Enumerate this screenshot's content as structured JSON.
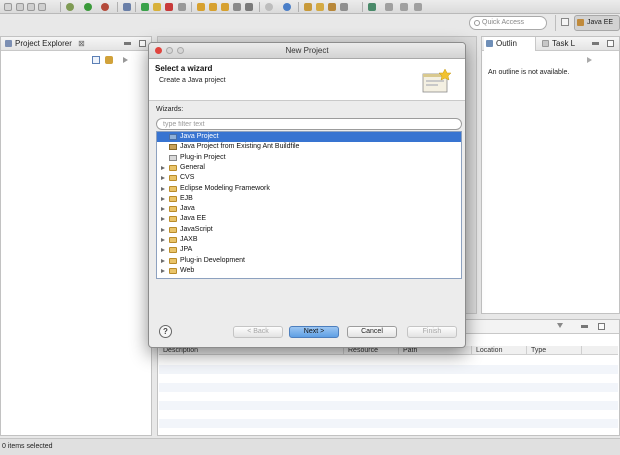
{
  "window": {
    "quick_access_placeholder": "Quick Access",
    "perspective_label": "Java EE"
  },
  "project_explorer": {
    "tab_label": "Project Explorer",
    "tab_close": "⊠"
  },
  "outline": {
    "tab_label": "Outlin",
    "second_tab_label": "Task L",
    "message": "An outline is not available."
  },
  "markers_table": {
    "columns": [
      "Description",
      "Resource",
      "Path",
      "Location",
      "Type"
    ]
  },
  "status_bar": {
    "text": "0 items selected"
  },
  "dialog": {
    "title": "New Project",
    "banner_title": "Select a wizard",
    "banner_description": "Create a Java project",
    "wizards_label": "Wizards:",
    "filter_placeholder": "type filter text",
    "tree": {
      "items": [
        {
          "label": "Java Project",
          "icon": "java-project-icon",
          "selected": true
        },
        {
          "label": "Java Project from Existing Ant Buildfile",
          "icon": "ant-project-icon"
        },
        {
          "label": "Plug-in Project",
          "icon": "plugin-project-icon"
        },
        {
          "label": "General",
          "icon": "folder-icon"
        },
        {
          "label": "CVS",
          "icon": "folder-icon"
        },
        {
          "label": "Eclipse Modeling Framework",
          "icon": "folder-icon"
        },
        {
          "label": "EJB",
          "icon": "folder-icon"
        },
        {
          "label": "Java",
          "icon": "folder-icon"
        },
        {
          "label": "Java EE",
          "icon": "folder-icon"
        },
        {
          "label": "JavaScript",
          "icon": "folder-icon"
        },
        {
          "label": "JAXB",
          "icon": "folder-icon"
        },
        {
          "label": "JPA",
          "icon": "folder-icon"
        },
        {
          "label": "Plug-in Development",
          "icon": "folder-icon"
        },
        {
          "label": "Web",
          "icon": "folder-icon"
        }
      ]
    },
    "help_label": "?",
    "buttons": {
      "back": "< Back",
      "next": "Next >",
      "cancel": "Cancel",
      "finish": "Finish"
    }
  },
  "colors": {
    "selection": "#3874d1",
    "default_button": "#5f9fe4"
  }
}
